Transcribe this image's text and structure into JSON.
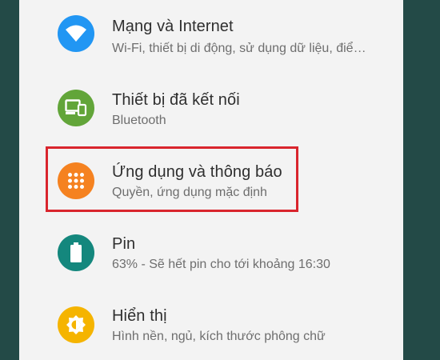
{
  "settings": {
    "items": [
      {
        "title": "Mạng và Internet",
        "subtitle": "Wi-Fi, thiết bị di động, sử dụng dữ liệu, điể…",
        "icon": "wifi-icon",
        "color": "#2196f3"
      },
      {
        "title": "Thiết bị đã kết nối",
        "subtitle": "Bluetooth",
        "icon": "connected-devices-icon",
        "color": "#62a539"
      },
      {
        "title": "Ứng dụng và thông báo",
        "subtitle": "Quyền, ứng dụng mặc định",
        "icon": "apps-grid-icon",
        "color": "#f58220"
      },
      {
        "title": "Pin",
        "subtitle": "63% - Sẽ hết pin cho tới khoảng 16:30",
        "icon": "battery-icon",
        "color": "#14877d"
      },
      {
        "title": "Hiển thị",
        "subtitle": "Hình nền, ngủ, kích thước phông chữ",
        "icon": "display-brightness-icon",
        "color": "#f5b400"
      }
    ]
  },
  "highlight": {
    "color": "#d9252d"
  },
  "background_color": "#234a47"
}
